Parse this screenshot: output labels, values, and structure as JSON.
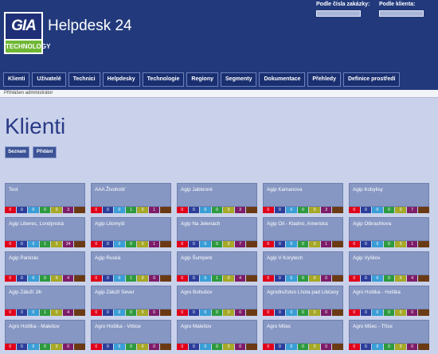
{
  "app": {
    "logo_text_top": "GIA",
    "logo_text_bottom": "TECHNOLOGY",
    "title": "Helpdesk 24"
  },
  "search": {
    "order_label": "Podle čísla zakázky:",
    "client_label": "Podle klienta:",
    "order_value": "",
    "client_value": ""
  },
  "nav": {
    "items": [
      "Klienti",
      "Uživatelé",
      "Technici",
      "Helpdesky",
      "Technologie",
      "Regiony",
      "Segmenty",
      "Dokumentace",
      "Přehledy",
      "Definice prostředí"
    ]
  },
  "userbar": {
    "text": "Přihlášen administrátor"
  },
  "page": {
    "title": "Klienti"
  },
  "subtabs": [
    "Seznam",
    "Přidání"
  ],
  "count_colors": [
    "#e0001a",
    "#2c3e9a",
    "#3a9ed6",
    "#2e9a3e",
    "#a6a826",
    "#7d1c68",
    "#6b3a14"
  ],
  "clients": [
    {
      "name": "Test",
      "counts": [
        "0",
        "0",
        "0",
        "0",
        "0",
        "3",
        ""
      ]
    },
    {
      "name": "AAA Živohošť",
      "counts": [
        "0",
        "0",
        "0",
        "1",
        "0",
        "1",
        ""
      ]
    },
    {
      "name": "Agip Jablonné",
      "counts": [
        "0",
        "0",
        "0",
        "0",
        "0",
        "3",
        ""
      ]
    },
    {
      "name": "Agip Kamanova",
      "counts": [
        "0",
        "0",
        "0",
        "0",
        "0",
        "3",
        ""
      ]
    },
    {
      "name": "Agip Kobylisy",
      "counts": [
        "0",
        "0",
        "0",
        "0",
        "0",
        "7",
        ""
      ]
    },
    {
      "name": "Agip Liberec, Londýnská",
      "counts": [
        "0",
        "0",
        "0",
        "1",
        "0",
        "24",
        ""
      ]
    },
    {
      "name": "Agip Litomyšl",
      "counts": [
        "0",
        "0",
        "0",
        "0",
        "0",
        "1",
        ""
      ]
    },
    {
      "name": "Agip Na Jelenách",
      "counts": [
        "0",
        "0",
        "0",
        "0",
        "0",
        "7",
        ""
      ]
    },
    {
      "name": "Agip Oil - Kladno, Americká",
      "counts": [
        "0",
        "0",
        "0",
        "0",
        "0",
        "1",
        ""
      ]
    },
    {
      "name": "Agip Olbrachtova",
      "counts": [
        "0",
        "0",
        "0",
        "0",
        "0",
        "1",
        ""
      ]
    },
    {
      "name": "Agip Pankrác",
      "counts": [
        "0",
        "0",
        "0",
        "0",
        "0",
        "4",
        ""
      ]
    },
    {
      "name": "Agip Ruská",
      "counts": [
        "0",
        "0",
        "0",
        "1",
        "0",
        "0",
        ""
      ]
    },
    {
      "name": "Agip Šumperk",
      "counts": [
        "0",
        "0",
        "0",
        "1",
        "0",
        "4",
        ""
      ]
    },
    {
      "name": "Agip V Korytech",
      "counts": [
        "0",
        "0",
        "0",
        "0",
        "0",
        "0",
        ""
      ]
    },
    {
      "name": "Agip Vyškov",
      "counts": [
        "0",
        "0",
        "0",
        "0",
        "0",
        "4",
        ""
      ]
    },
    {
      "name": "Agip Záluží Jih",
      "counts": [
        "0",
        "0",
        "0",
        "1",
        "0",
        "4",
        ""
      ]
    },
    {
      "name": "Agip Záluží Sever",
      "counts": [
        "0",
        "0",
        "0",
        "0",
        "0",
        "0",
        ""
      ]
    },
    {
      "name": "Agro Bohušov",
      "counts": [
        "0",
        "0",
        "0",
        "0",
        "0",
        "0",
        ""
      ]
    },
    {
      "name": "Agrodružstvo Lhota pad Libčany",
      "counts": [
        "0",
        "0",
        "0",
        "0",
        "0",
        "0",
        ""
      ]
    },
    {
      "name": "Agro Hoštka - Hoštka",
      "counts": [
        "0",
        "0",
        "0",
        "0",
        "0",
        "0",
        ""
      ]
    },
    {
      "name": "Agro Hoštka - Malešov",
      "counts": [
        "0",
        "0",
        "0",
        "0",
        "0",
        "0",
        ""
      ]
    },
    {
      "name": "Agro Hoštka - Vrbice",
      "counts": [
        "0",
        "0",
        "0",
        "0",
        "0",
        "0",
        ""
      ]
    },
    {
      "name": "Agro Malešov",
      "counts": [
        "0",
        "0",
        "0",
        "0",
        "0",
        "0",
        ""
      ]
    },
    {
      "name": "Agro Mšec",
      "counts": [
        "0",
        "0",
        "0",
        "0",
        "0",
        "0",
        ""
      ]
    },
    {
      "name": "Agro Mšec - Tříce",
      "counts": [
        "0",
        "0",
        "0",
        "0",
        "0",
        "0",
        ""
      ]
    }
  ]
}
